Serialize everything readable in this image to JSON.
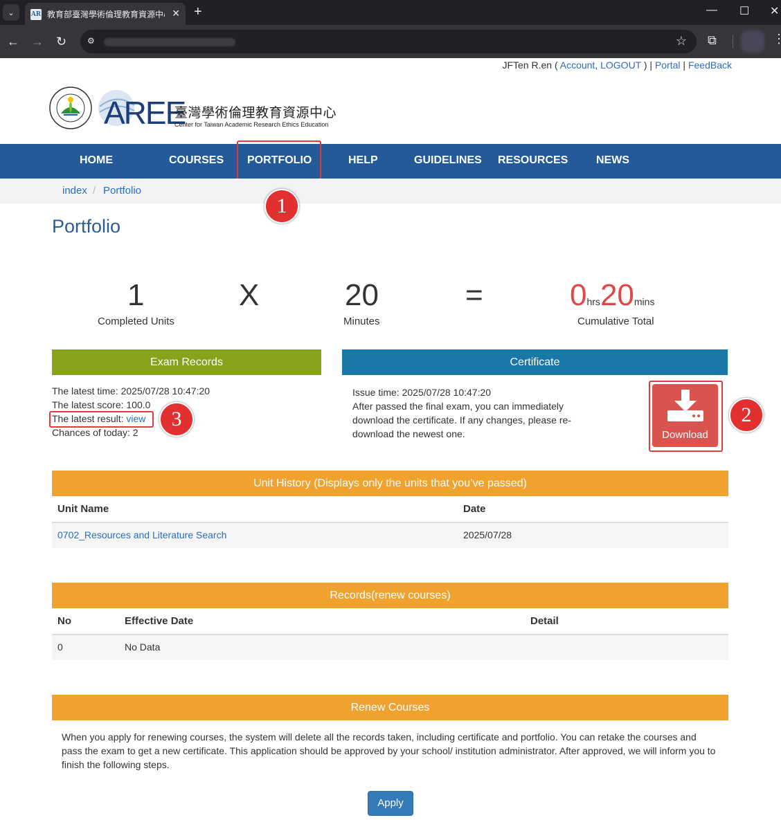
{
  "browser": {
    "tab_title": "教育部臺灣學術倫理教育資源中心",
    "tab_favicon": "AR",
    "tab_close": "✕",
    "new_tab": "+",
    "minimize": "—",
    "maximize": "☐",
    "close": "✕",
    "back": "←",
    "forward": "→",
    "reload": "↻",
    "bookmark": "☆",
    "extensions": "⧉",
    "menu": "⋮"
  },
  "userbar": {
    "username": "JFTen R.en",
    "open_paren": " ( ",
    "account": "Account",
    "comma": ", ",
    "logout": "LOGOUT",
    "close_paren": " ) | ",
    "portal": "Portal",
    "pipe": " | ",
    "feedback": "FeedBack"
  },
  "logo": {
    "seal_text": "MINISTRY OF EDUCATION",
    "seal_bottom": "教育部",
    "aree": "AREE",
    "zh_title": "臺灣學術倫理教育資源中心",
    "en_subtitle": "Center for Taiwan Academic Research Ethics Education"
  },
  "nav": {
    "items": [
      "HOME",
      "COURSES",
      "PORTFOLIO",
      "HELP",
      "GUIDELINES",
      "RESOURCES",
      "NEWS"
    ]
  },
  "breadcrumb": {
    "home": "index",
    "separator": "/",
    "current": "Portfolio"
  },
  "annotations": [
    "1",
    "2",
    "3"
  ],
  "page_title": "Portfolio",
  "summary": {
    "units": "1",
    "units_label": "Completed Units",
    "times": "X",
    "minutes": "20",
    "minutes_label": "Minutes",
    "equals": "=",
    "hrs_value": "0",
    "hrs_unit": "hrs",
    "mins_value": "20",
    "mins_unit": "mins",
    "total_label": "Cumulative Total"
  },
  "exam": {
    "header": "Exam Records",
    "header_color": "#86a31a",
    "latest_time": "The latest time: 2025/07/28 10:47:20",
    "latest_score": "The latest score: 100.0",
    "latest_result_label": "The latest result: ",
    "latest_result_link": "view",
    "chances": "Chances of today: 2"
  },
  "certificate": {
    "header": "Certificate",
    "header_color": "#1a78a8",
    "issue_time": "Issue time: 2025/07/28 10:47:20",
    "description": "After passed the final exam, you can immediately download the certificate. If any changes, please re-download the newest one.",
    "download_label": "Download"
  },
  "unit_history": {
    "header": "Unit History (Displays only the units that you’ve passed)",
    "header_color": "#f0a22e",
    "columns": [
      "Unit Name",
      "Date"
    ],
    "rows": [
      {
        "name": "0702_Resources and Literature Search",
        "date": "2025/07/28"
      }
    ]
  },
  "records": {
    "header": "Records(renew courses)",
    "columns": [
      "No",
      "Effective Date",
      "Detail"
    ],
    "rows": [
      {
        "no": "0",
        "effective_date": "No Data",
        "detail": ""
      }
    ]
  },
  "renew": {
    "header": "Renew Courses",
    "text": "When you apply for renewing courses, the system will delete all the records taken, including certificate and portfolio. You can retake the courses and pass the exam to get a new certificate. This application should be approved by your school/ institution administrator. After approved, we will inform you to finish the following steps.",
    "apply_label": "Apply"
  }
}
